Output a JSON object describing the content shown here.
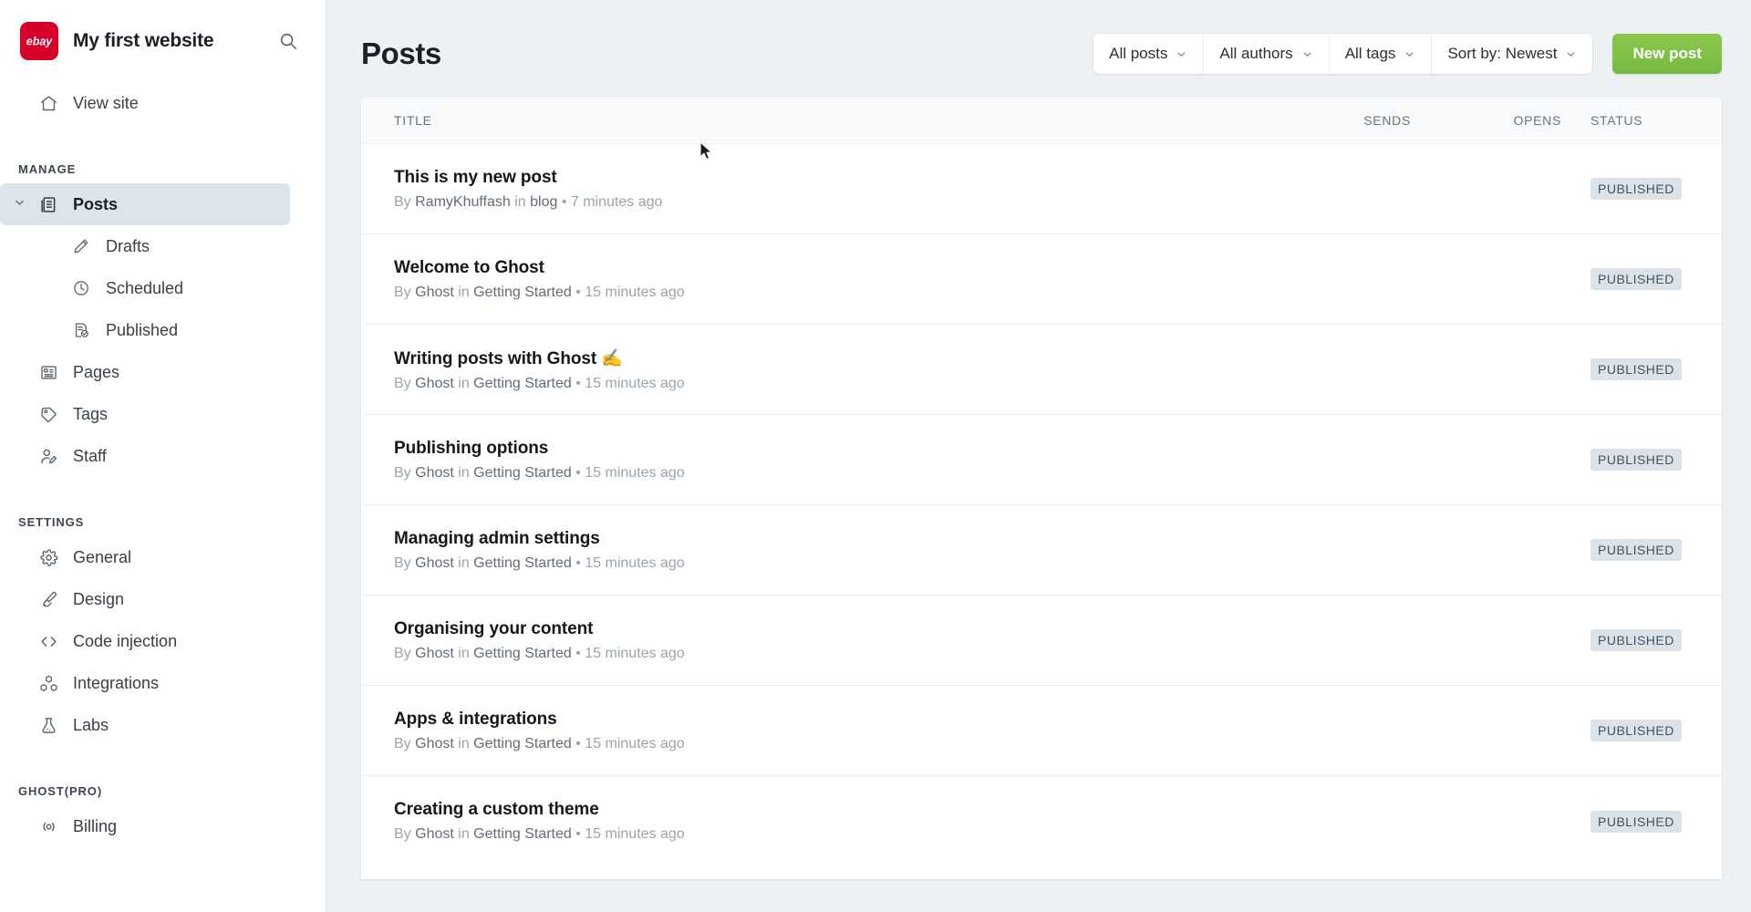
{
  "sidebar": {
    "brand": {
      "logo_text": "ebay",
      "logo_color": "#d6002a",
      "site_name": "My first website",
      "search_icon": "search-icon"
    },
    "view_site": {
      "label": "View site",
      "icon": "home-icon"
    },
    "sections": [
      {
        "label": "MANAGE",
        "items": [
          {
            "label": "Posts",
            "icon": "posts-icon",
            "active": true,
            "expanded": true,
            "children": [
              {
                "label": "Drafts",
                "icon": "pencil-icon"
              },
              {
                "label": "Scheduled",
                "icon": "clock-icon"
              },
              {
                "label": "Published",
                "icon": "document-check-icon"
              }
            ]
          },
          {
            "label": "Pages",
            "icon": "pages-icon"
          },
          {
            "label": "Tags",
            "icon": "tag-icon"
          },
          {
            "label": "Staff",
            "icon": "user-edit-icon"
          }
        ]
      },
      {
        "label": "SETTINGS",
        "items": [
          {
            "label": "General",
            "icon": "gear-icon"
          },
          {
            "label": "Design",
            "icon": "paintbrush-icon"
          },
          {
            "label": "Code injection",
            "icon": "code-brackets-icon"
          },
          {
            "label": "Integrations",
            "icon": "integrations-icon"
          },
          {
            "label": "Labs",
            "icon": "flask-icon"
          }
        ]
      },
      {
        "label": "GHOST(PRO)",
        "items": [
          {
            "label": "Billing",
            "icon": "billing-icon"
          }
        ]
      }
    ]
  },
  "header": {
    "title": "Posts",
    "filters": [
      {
        "label": "All posts",
        "caret": "chevron-down-icon"
      },
      {
        "label": "All authors",
        "caret": "chevron-down-icon"
      },
      {
        "label": "All tags",
        "caret": "chevron-down-icon"
      },
      {
        "label": "Sort by: Newest",
        "caret": "chevron-down-icon"
      }
    ],
    "new_post_label": "New post",
    "new_post_color": "#7fc242"
  },
  "table": {
    "columns": {
      "title": "TITLE",
      "sends": "SENDS",
      "opens": "OPENS",
      "status": "STATUS"
    },
    "rows": [
      {
        "title": "This is my new post",
        "by_prefix": "By ",
        "author": "RamyKhuffash",
        "in_text": " in ",
        "tag": "blog",
        "separator": " • ",
        "time": "7 minutes ago",
        "sends": "",
        "opens": "",
        "status": "PUBLISHED"
      },
      {
        "title": "Welcome to Ghost",
        "by_prefix": "By ",
        "author": "Ghost",
        "in_text": " in ",
        "tag": "Getting Started",
        "separator": " • ",
        "time": "15 minutes ago",
        "sends": "",
        "opens": "",
        "status": "PUBLISHED"
      },
      {
        "title": "Writing posts with Ghost ✍️",
        "by_prefix": "By ",
        "author": "Ghost",
        "in_text": " in ",
        "tag": "Getting Started",
        "separator": " • ",
        "time": "15 minutes ago",
        "sends": "",
        "opens": "",
        "status": "PUBLISHED"
      },
      {
        "title": "Publishing options",
        "by_prefix": "By ",
        "author": "Ghost",
        "in_text": " in ",
        "tag": "Getting Started",
        "separator": " • ",
        "time": "15 minutes ago",
        "sends": "",
        "opens": "",
        "status": "PUBLISHED"
      },
      {
        "title": "Managing admin settings",
        "by_prefix": "By ",
        "author": "Ghost",
        "in_text": " in ",
        "tag": "Getting Started",
        "separator": " • ",
        "time": "15 minutes ago",
        "sends": "",
        "opens": "",
        "status": "PUBLISHED"
      },
      {
        "title": "Organising your content",
        "by_prefix": "By ",
        "author": "Ghost",
        "in_text": " in ",
        "tag": "Getting Started",
        "separator": " • ",
        "time": "15 minutes ago",
        "sends": "",
        "opens": "",
        "status": "PUBLISHED"
      },
      {
        "title": "Apps & integrations",
        "by_prefix": "By ",
        "author": "Ghost",
        "in_text": " in ",
        "tag": "Getting Started",
        "separator": " • ",
        "time": "15 minutes ago",
        "sends": "",
        "opens": "",
        "status": "PUBLISHED"
      },
      {
        "title": "Creating a custom theme",
        "by_prefix": "By ",
        "author": "Ghost",
        "in_text": " in ",
        "tag": "Getting Started",
        "separator": " • ",
        "time": "15 minutes ago",
        "sends": "",
        "opens": "",
        "status": "PUBLISHED"
      }
    ]
  }
}
